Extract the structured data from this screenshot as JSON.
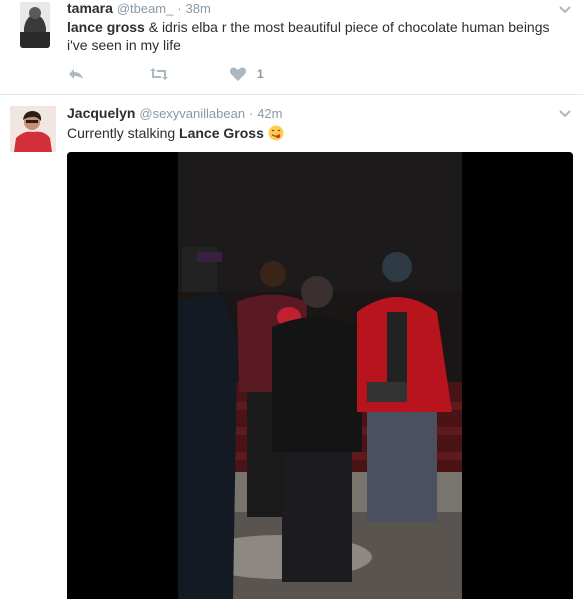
{
  "tweets": [
    {
      "name": "tamara",
      "handle": "@tbeam_",
      "separator": "·",
      "time": "38m",
      "text_bold": "lance gross",
      "text_rest": " & idris elba r the most beautiful piece of chocolate human beings i've seen in my life",
      "likes": "1",
      "icons": [
        "reply-icon",
        "retweet-icon",
        "heart-icon",
        "caret-down-icon"
      ]
    },
    {
      "name": "Jacquelyn",
      "handle": "@sexyvanillabean",
      "separator": "·",
      "time": "42m",
      "text_plain": "Currently stalking ",
      "text_bold": "Lance Gross",
      "emoji": "face-savoring-food-emoji",
      "media": "video-still",
      "icons": [
        "caret-down-icon"
      ]
    }
  ],
  "colors": {
    "text": "#292f33",
    "muted": "#8899a6",
    "divider": "#e1e8ed",
    "icon": "#aab8c2",
    "emoji": "#ffcc4d"
  }
}
